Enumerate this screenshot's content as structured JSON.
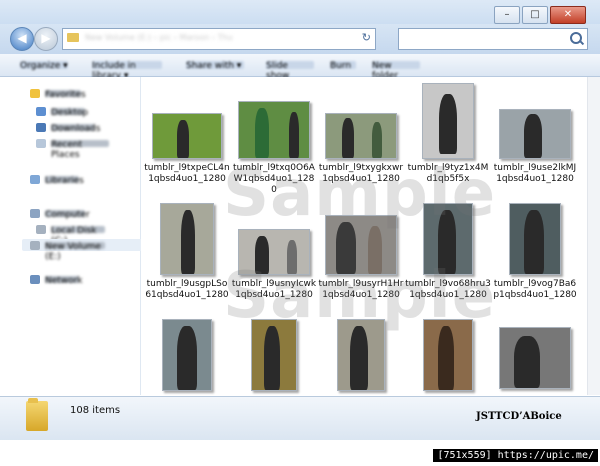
{
  "window": {
    "minimize": "–",
    "maximize": "□",
    "close": "✕"
  },
  "address": {
    "path": "New Volume (E:) › pic › Maroon › Thu",
    "refresh": "↻",
    "search_placeholder": ""
  },
  "nav": {
    "back": "◀",
    "forward": "▶"
  },
  "toolbar": {
    "items": [
      "Organize ▾",
      "Include in library ▾",
      "Share with ▾",
      "Slide show",
      "Burn",
      "New folder"
    ]
  },
  "sidebar": {
    "items": [
      {
        "label": "Favorites"
      },
      {
        "label": "Desktop"
      },
      {
        "label": "Downloads"
      },
      {
        "label": "Recent Places"
      },
      {
        "label": "Libraries"
      },
      {
        "label": "Computer"
      },
      {
        "label": "Local Disk (C:)"
      },
      {
        "label": "New Volume (E:)"
      },
      {
        "label": "Network"
      }
    ]
  },
  "files": [
    {
      "name": "tumblr_l9txpeCL4n1qbsd4uo1_1280",
      "bg": "#6f9a3a"
    },
    {
      "name": "tumblr_l9txq0O6AW1qbsd4uo1_1280",
      "bg": "#5f8d43"
    },
    {
      "name": "tumblr_l9txygkxwr1qbsd4uo1_1280",
      "bg": "#8c9a7c"
    },
    {
      "name": "tumblr_l9tyz1x4Md1qb5f5x",
      "bg": "#c7c7c7"
    },
    {
      "name": "tumblr_l9use2lkMJ1qbsd4uo1_1280",
      "bg": "#9aa3a8"
    },
    {
      "name": "tumblr_l9usgpLSo61qbsd4uo1_1280",
      "bg": "#a7a89a"
    },
    {
      "name": "tumblr_l9usnyIcwk1qbsd4uo1_1280",
      "bg": "#b8b6b0"
    },
    {
      "name": "tumblr_l9usyrH1Hr1qbsd4uo1_1280",
      "bg": "#8d8a86"
    },
    {
      "name": "tumblr_l9vo68hru31qbsd4uo1_1280",
      "bg": "#5d6a6d"
    },
    {
      "name": "tumblr_l9vog7Ba6p1qbsd4uo1_1280",
      "bg": "#4f5d60"
    },
    {
      "name": "",
      "bg": "#7b8a8f"
    },
    {
      "name": "",
      "bg": "#8c7a3d"
    },
    {
      "name": "",
      "bg": "#9d9a8c"
    },
    {
      "name": "",
      "bg": "#8a6a4a"
    },
    {
      "name": "",
      "bg": "#777777"
    }
  ],
  "watermark": "Sample",
  "status": {
    "count": "108 items",
    "signature": "JSTTCD’ABoice"
  },
  "upic": "[751x559] https://upic.me/"
}
